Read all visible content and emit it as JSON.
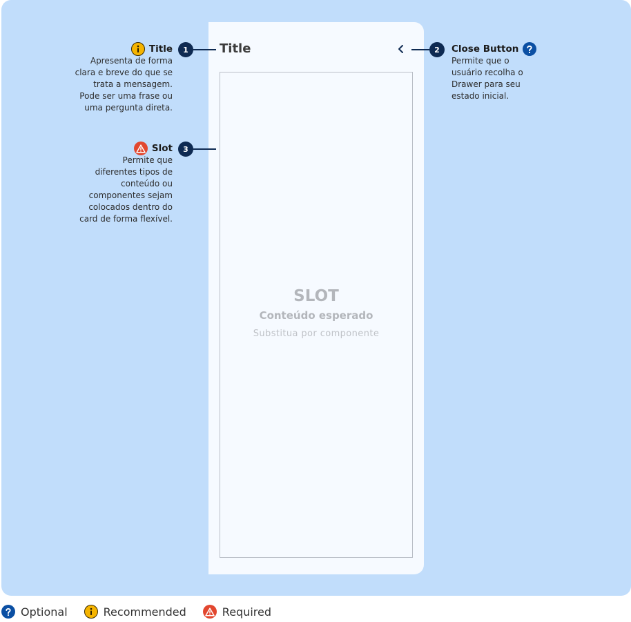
{
  "drawer": {
    "title": "Title",
    "slot": {
      "heading": "SLOT",
      "subheading": "Conteúdo esperado",
      "hint": "Substitua por componente"
    }
  },
  "annotations": [
    {
      "number": "1",
      "label": "Title",
      "status": "recommended",
      "description": "Apresenta de forma\nclara e breve do que se\ntrata a mensagem.\nPode ser uma frase ou\numa pergunta direta."
    },
    {
      "number": "2",
      "label": "Close Button",
      "status": "optional",
      "description": "Permite que o\nusuário recolha o\nDrawer para seu\nestado inicial."
    },
    {
      "number": "3",
      "label": "Slot",
      "status": "required",
      "description": "Permite que\ndiferentes tipos de\nconteúdo ou\ncomponentes sejam\ncolocados dentro do\ncard de forma flexível."
    }
  ],
  "legend": {
    "optional": "Optional",
    "recommended": "Recommended",
    "required": "Required"
  },
  "colors": {
    "canvas": "#c1ddfb",
    "drawer": "#f6faff",
    "marker": "#0e2a52",
    "optional": "#0b4fa3",
    "recommended": "#f5b400",
    "required": "#e2472f"
  },
  "icons": {
    "optional": "question-icon",
    "recommended": "info-icon",
    "required": "warning-icon",
    "close": "chevron-left-icon"
  }
}
